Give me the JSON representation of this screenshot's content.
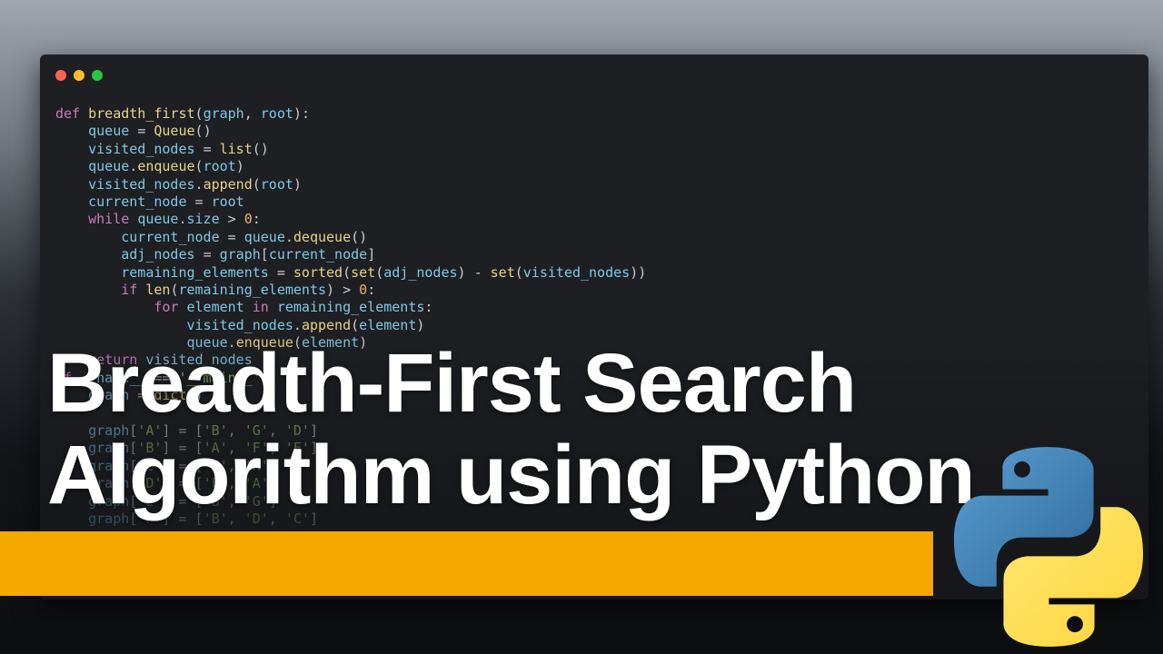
{
  "window": {
    "controls": [
      "close-dot",
      "minimize-dot",
      "maximize-dot"
    ]
  },
  "code_lines": [
    "def breadth_first(graph, root):",
    "    queue = Queue()",
    "    visited_nodes = list()",
    "    queue.enqueue(root)",
    "    visited_nodes.append(root)",
    "    current_node = root",
    "    while queue.size > 0:",
    "        current_node = queue.dequeue()",
    "        adj_nodes = graph[current_node]",
    "        remaining_elements = sorted(set(adj_nodes) - set(visited_nodes))",
    "        if len(remaining_elements) > 0:",
    "            for element in remaining_elements:",
    "                visited_nodes.append(element)",
    "                queue.enqueue(element)",
    "    return visited_nodes",
    "if __name__ == '__main__':",
    "    graph = dict()",
    "",
    "    graph['A'] = ['B', 'G', 'D']",
    "    graph['B'] = ['A', 'F', 'E']",
    "    graph['C'] = ['F', 'H']",
    "    graph['D'] = ['F', 'A']",
    "    graph['E'] = ['B', 'G']",
    "    graph['F'] = ['B', 'D', 'C']"
  ],
  "title": {
    "line1": "Breadth-First Search",
    "line2": "Algorithm using Python"
  },
  "logo": {
    "name": "python-logo",
    "colors": {
      "blue": "#3a75b0",
      "yellow": "#ffd43b"
    }
  },
  "colors": {
    "accent_band": "#f5a800",
    "editor_background": "#1e1f22"
  }
}
